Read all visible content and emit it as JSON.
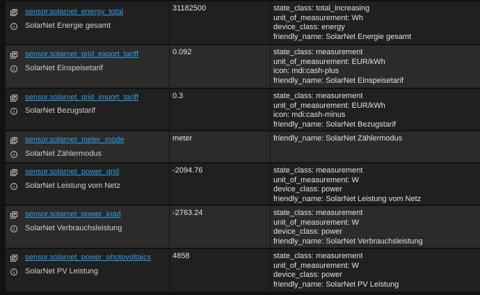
{
  "rows": [
    {
      "entity_id": "sensor.solarnet_energy_total",
      "friendly_name": "SolarNet Energie gesamt",
      "state": "31182500",
      "attributes": [
        "state_class: total_increasing",
        "unit_of_measurement: Wh",
        "device_class: energy",
        "friendly_name: SolarNet Energie gesamt"
      ]
    },
    {
      "entity_id": "sensor.solarnet_grid_export_tariff",
      "friendly_name": "SolarNet Einspeisetarif",
      "state": "0.092",
      "attributes": [
        "state_class: measurement",
        "unit_of_measurement: EUR/kWh",
        "icon: mdi:cash-plus",
        "friendly_name: SolarNet Einspeisetarif"
      ]
    },
    {
      "entity_id": "sensor.solarnet_grid_import_tariff",
      "friendly_name": "SolarNet Bezugstarif",
      "state": "0.3",
      "attributes": [
        "state_class: measurement",
        "unit_of_measurement: EUR/kWh",
        "icon: mdi:cash-minus",
        "friendly_name: SolarNet Bezugstarif"
      ]
    },
    {
      "entity_id": "sensor.solarnet_meter_mode",
      "friendly_name": "SolarNet Zählermodus",
      "state": "meter",
      "attributes": [
        "friendly_name: SolarNet Zählermodus"
      ]
    },
    {
      "entity_id": "sensor.solarnet_power_grid",
      "friendly_name": "SolarNet Leistung vom Netz",
      "state": "-2094.76",
      "attributes": [
        "state_class: measurement",
        "unit_of_measurement: W",
        "device_class: power",
        "friendly_name: SolarNet Leistung vom Netz"
      ]
    },
    {
      "entity_id": "sensor.solarnet_power_load",
      "friendly_name": "SolarNet Verbrauchsleistung",
      "state": "-2763.24",
      "attributes": [
        "state_class: measurement",
        "unit_of_measurement: W",
        "device_class: power",
        "friendly_name: SolarNet Verbrauchsleistung"
      ]
    },
    {
      "entity_id": "sensor.solarnet_power_photovoltaics",
      "friendly_name": "SolarNet PV Leistung",
      "state": "4858",
      "attributes": [
        "state_class: measurement",
        "unit_of_measurement: W",
        "device_class: power",
        "friendly_name: SolarNet PV Leistung"
      ]
    }
  ],
  "icons": {
    "copy": "copy-icon",
    "info": "info-icon"
  },
  "colors": {
    "link": "#2f9ee8",
    "row_dark": "#202020",
    "row_light": "#2b2b2b",
    "background": "#111111"
  }
}
